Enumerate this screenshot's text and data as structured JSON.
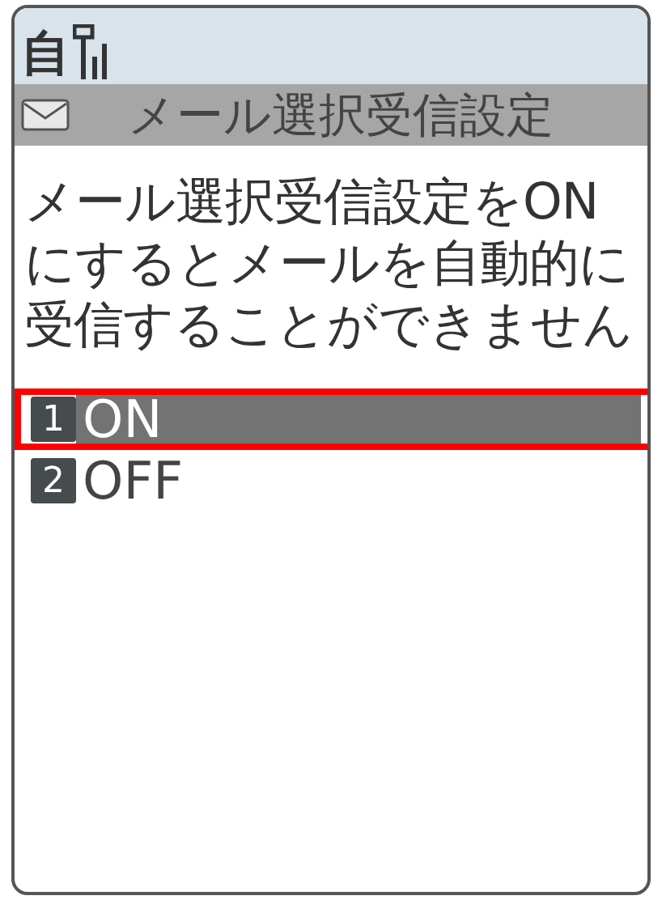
{
  "status_bar": {
    "mode_glyph": "自"
  },
  "title_bar": {
    "title": "メール選択受信設定"
  },
  "message": "メール選択受信設定をONにするとメールを自動的に受信することができません",
  "options": [
    {
      "number": "1",
      "label": "ON",
      "selected": true,
      "highlighted": true
    },
    {
      "number": "2",
      "label": "OFF",
      "selected": false,
      "highlighted": false
    }
  ]
}
